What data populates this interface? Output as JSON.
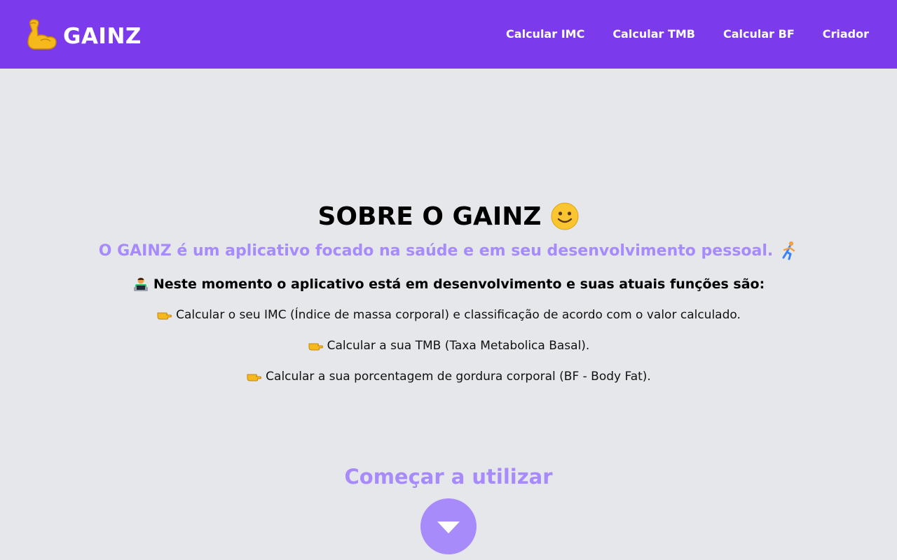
{
  "header": {
    "brand": "GAINZ",
    "nav": [
      {
        "label": "Calcular IMC"
      },
      {
        "label": "Calcular TMB"
      },
      {
        "label": "Calcular BF"
      },
      {
        "label": "Criador"
      }
    ]
  },
  "about": {
    "title": "SOBRE O GAINZ",
    "subtitle": "O GAINZ é um aplicativo focado na saúde e em seu desenvolvimento pessoal.",
    "dev_note": "Neste momento o aplicativo está em desenvolvimento e suas atuais funções são:",
    "features": [
      "Calcular o seu IMC (Índice de massa corporal) e classificação de acordo com o valor calculado.",
      "Calcular a sua TMB (Taxa Metabolica Basal).",
      "Calcular a sua porcentagem de gordura corporal (BF - Body Fat)."
    ]
  },
  "cta": {
    "label": "Começar a utilizar"
  },
  "icons": {
    "brand": "flexed-biceps-icon",
    "title": "smiley-icon",
    "subtitle": "running-person-icon",
    "dev_note": "technologist-icon",
    "feature_bullet": "pointing-right-icon",
    "cta": "arrow-down-icon"
  },
  "colors": {
    "header_bg": "#7c3aed",
    "page_bg": "#e5e7eb",
    "accent": "#a78bfa",
    "text": "#000000",
    "nav_text": "#ffffff"
  }
}
